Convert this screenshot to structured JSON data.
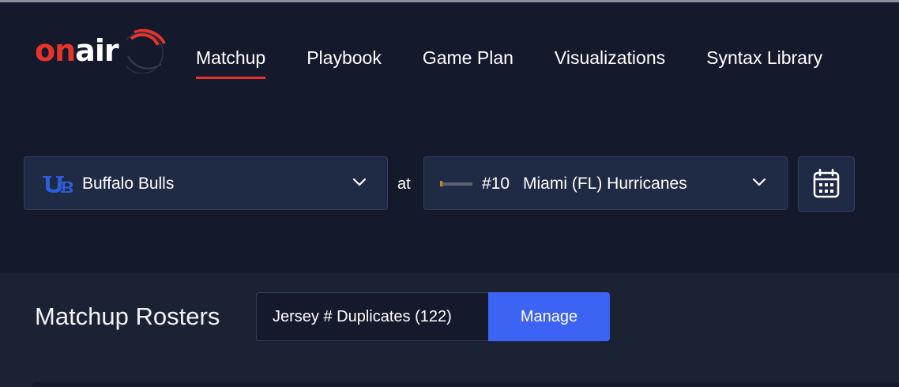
{
  "brand": {
    "logo_on": "on",
    "logo_air": "air",
    "logo_red": "#e8332a"
  },
  "nav": {
    "items": [
      {
        "label": "Matchup",
        "active": true
      },
      {
        "label": "Playbook",
        "active": false
      },
      {
        "label": "Game Plan",
        "active": false
      },
      {
        "label": "Visualizations",
        "active": false
      },
      {
        "label": "Syntax Library",
        "active": false
      }
    ]
  },
  "matchup": {
    "home_team": {
      "name": "Buffalo Bulls",
      "logo_icon": "ub-logo-icon",
      "logo_color": "#2b5fd9"
    },
    "at_label": "at",
    "away_team": {
      "rank": "#10",
      "name": "Miami (FL) Hurricanes",
      "logo_icon": "miami-logo-icon"
    },
    "calendar_icon": "calendar-icon"
  },
  "rosters": {
    "title": "Matchup Rosters",
    "duplicates_label": "Jersey # Duplicates (122)",
    "manage_label": "Manage",
    "accent": "#3d63f5"
  }
}
